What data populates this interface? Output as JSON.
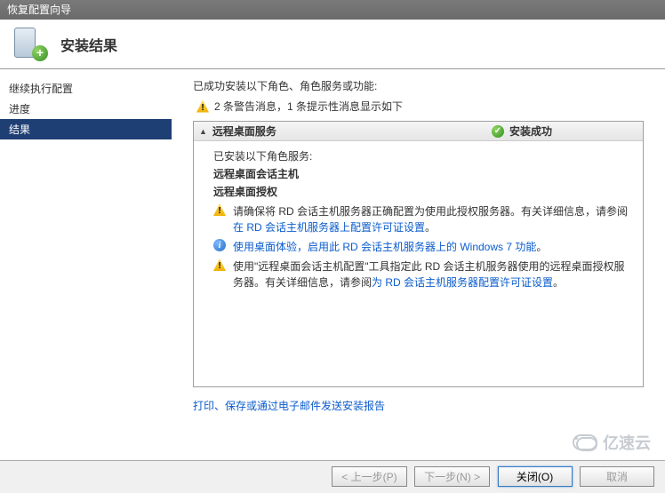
{
  "window": {
    "title": "恢复配置向导"
  },
  "header": {
    "title": "安装结果"
  },
  "sidebar": {
    "items": [
      {
        "label": "继续执行配置"
      },
      {
        "label": "进度"
      },
      {
        "label": "结果"
      }
    ],
    "selected_index": 2
  },
  "content": {
    "intro": "已成功安装以下角色、角色服务或功能:",
    "warning_summary": "2 条警告消息，1 条提示性消息显示如下",
    "panel": {
      "title": "远程桌面服务",
      "status": "安装成功",
      "installed_label": "已安装以下角色服务:",
      "role1": "远程桌面会话主机",
      "role2": "远程桌面授权",
      "msg1_a": "请确保将 RD 会话主机服务器正确配置为使用此授权服务器。有关详细信息，请参阅",
      "msg1_link": "在 RD 会话主机服务器上配置许可证设置",
      "msg1_b": "。",
      "msg2_a": "使用桌面体验，启用此 RD 会话主机服务器上的 Windows 7 功能",
      "msg2_b": "。",
      "msg3_a": "使用\"远程桌面会话主机配置\"工具指定此 RD 会话主机服务器使用的远程桌面授权服务器。有关详细信息，请参阅",
      "msg3_link": "为 RD 会话主机服务器配置许可证设置",
      "msg3_b": "。"
    },
    "report_link": "打印、保存或通过电子邮件发送安装报告"
  },
  "footer": {
    "prev": "< 上一步(P)",
    "next": "下一步(N) >",
    "close": "关闭(O)",
    "cancel": "取消"
  },
  "watermark": "亿速云"
}
